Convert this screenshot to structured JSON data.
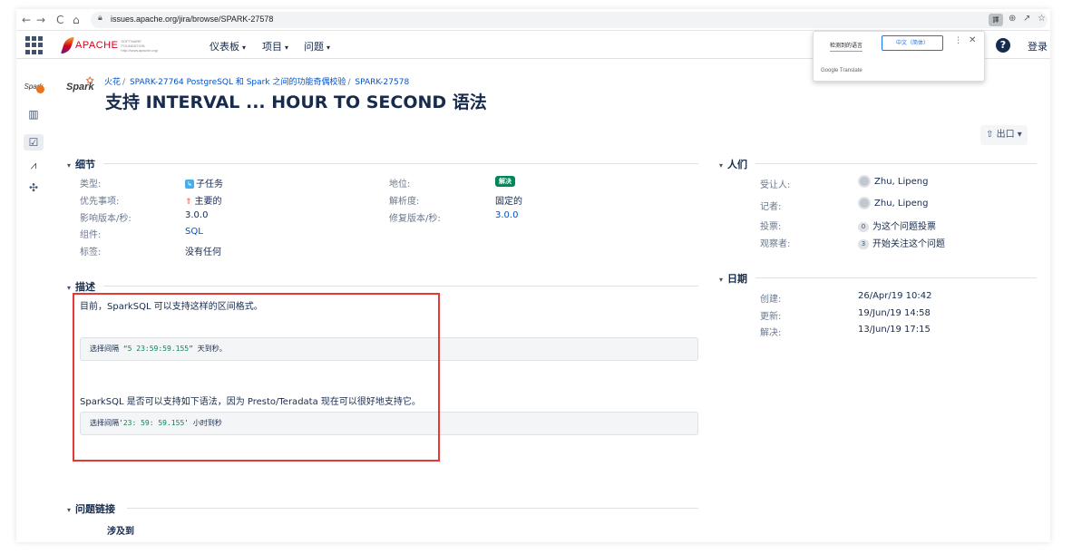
{
  "browser": {
    "back": "←",
    "forward": "→",
    "reload": "C",
    "home": "⌂",
    "url": "issues.apache.org/jira/browse/SPARK-27578",
    "translate_chip": "譯"
  },
  "header": {
    "logo_text": "APACHE",
    "logo_sub": "SOFTWARE FOUNDATION http://www.apache.org/",
    "menu_dashboards": "仪表板",
    "menu_projects": "项目",
    "menu_issues": "问题",
    "login": "登录"
  },
  "translate_popup": {
    "detected": "检测到的语言",
    "target": "中文（简体）",
    "footer": "Google Translate"
  },
  "breadcrumb": {
    "project": "火花",
    "parent": "SPARK-27764 PostgreSQL 和 Spark 之间的功能奇偶校验",
    "issue": "SPARK-27578"
  },
  "issue": {
    "project_logo": "Spark",
    "title": "支持 INTERVAL ... HOUR TO SECOND 语法",
    "export_label": "出口"
  },
  "details": {
    "heading": "细节",
    "type_label": "类型:",
    "type_value": "子任务",
    "priority_label": "优先事项:",
    "priority_value": "主要的",
    "affects_label": "影响版本/秒:",
    "affects_value": "3.0.0",
    "component_label": "组件:",
    "component_value": "SQL",
    "labels_label": "标签:",
    "labels_value": "没有任何",
    "status_label": "地位:",
    "status_value": "解决",
    "resolution_label": "解析度:",
    "resolution_value": "固定的",
    "fix_label": "修复版本/秒:",
    "fix_value": "3.0.0"
  },
  "people": {
    "heading": "人们",
    "assignee_label": "受让人:",
    "assignee_value": "Zhu, Lipeng",
    "reporter_label": "记者:",
    "reporter_value": "Zhu, Lipeng",
    "votes_label": "投票:",
    "votes_count": "0",
    "votes_text": "为这个问题投票",
    "watchers_label": "观察者:",
    "watchers_count": "3",
    "watchers_text": "开始关注这个问题"
  },
  "dates": {
    "heading": "日期",
    "created_label": "创建:",
    "created_value": "26/Apr/19 10:42",
    "updated_label": "更新:",
    "updated_value": "19/Jun/19 14:58",
    "resolved_label": "解决:",
    "resolved_value": "13/Jun/19 17:15"
  },
  "description": {
    "heading": "描述",
    "line1": "目前，SparkSQL 可以支持这样的区间格式。",
    "code1_prefix": "选择间隔 ",
    "code1_str": "“5 23:59:59.155”",
    "code1_suffix": " 天到秒。",
    "line2": "SparkSQL 是否可以支持如下语法，因为 Presto/Teradata 现在可以很好地支持它。",
    "code2_prefix": "选择间隔'",
    "code2_str": "23: 59: 59.155",
    "code2_suffix": "' 小时到秒"
  },
  "issue_links": {
    "heading": "问题链接",
    "relates": "涉及到"
  }
}
